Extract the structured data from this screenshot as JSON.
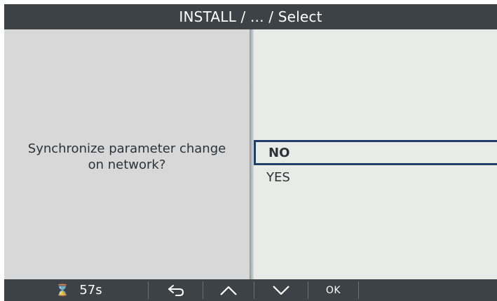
{
  "header": {
    "title": "INSTALL / ... / Select"
  },
  "question": {
    "text": "Synchronize parameter change on network?"
  },
  "options": {
    "items": [
      {
        "label": "NO",
        "selected": true
      },
      {
        "label": "YES",
        "selected": false
      }
    ]
  },
  "footer": {
    "timer_icon": "hourglass-icon",
    "timer_value": "57s",
    "back_icon": "back-arrow-icon",
    "up_icon": "chevron-up-icon",
    "down_icon": "chevron-down-icon",
    "ok_label": "OK"
  },
  "colors": {
    "header_bg": "#3d4246",
    "left_panel_bg": "#d8d8d8",
    "right_panel_bg": "#e8ebe8",
    "selection_border": "#1f3f66",
    "text": "#2e3236"
  }
}
